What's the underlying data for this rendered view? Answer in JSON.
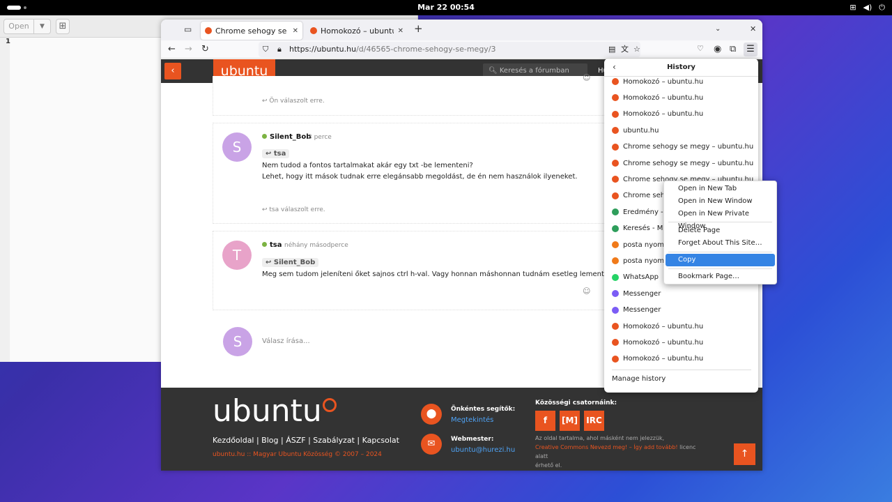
{
  "system": {
    "clock": "Mar 22  00:54",
    "tray": [
      "network-icon",
      "volume-icon",
      "power-icon"
    ]
  },
  "editor": {
    "open_label": "Open",
    "line_number": "1"
  },
  "browser": {
    "tabs": [
      {
        "title": "Chrome sehogy se megy – ubuntu.hu",
        "active": true
      },
      {
        "title": "Homokozó – ubuntu.hu",
        "active": false
      }
    ],
    "url_host": "https://ubuntu.hu",
    "url_path": "/d/46565-chrome-sehogy-se-megy/3"
  },
  "site": {
    "logo": "ubuntu",
    "search_placeholder": "Keresés a fórumban",
    "head_text": "Hu"
  },
  "posts": [
    {
      "replied": "Ön válaszolt erre."
    },
    {
      "initial": "S",
      "color": "#c9a3e6",
      "user": "Silent_Bob",
      "time": "3 perce",
      "reply_to": "tsa",
      "lines": [
        "Nem tudod a fontos tartalmakat akár egy txt -be lementeni?",
        "Lehet, hogy itt mások tudnak erre elegánsabb megoldást, de én nem használok ilyeneket."
      ],
      "replied": "tsa válaszolt erre."
    },
    {
      "initial": "T",
      "color": "#e8a3c9",
      "user": "tsa",
      "time": "néhány másodperce",
      "reply_to": "Silent_Bob",
      "lines": [
        "Meg sem tudom jeleníteni őket sajnos ctrl h-val. Vagy honnan máshonnan tudnám esetleg lementeni?"
      ]
    }
  ],
  "reply_box": {
    "initial": "S",
    "placeholder": "Válasz írása..."
  },
  "footer": {
    "logo": "ubuntu",
    "links": "Kezdőoldal | Blog | ÁSZF | Szabályzat | Kapcsolat",
    "copyright": "ubuntu.hu :: Magyar Ubuntu Közösség © 2007 – 2024",
    "helpers_title": "Önkéntes segítők:",
    "helpers_link": "Megtekintés",
    "webmaster_title": "Webmester:",
    "webmaster_link": "ubuntu@hurezi.hu",
    "social_title": "Közösségi csatornáink:",
    "social": [
      "f",
      "[M]",
      "IRC"
    ],
    "license_1": "Az oldal tartalma, ahol másként nem jelezzük,",
    "license_link": "Creative Commons Nevezd meg! – Így add tovább!",
    "license_2": " licenc alatt",
    "license_3": "érhető el."
  },
  "history": {
    "title": "History",
    "items": [
      {
        "label": "Homokozó – ubuntu.hu",
        "color": "#e95420"
      },
      {
        "label": "Homokozó – ubuntu.hu",
        "color": "#e95420"
      },
      {
        "label": "Homokozó – ubuntu.hu",
        "color": "#e95420"
      },
      {
        "label": "ubuntu.hu",
        "color": "#e95420"
      },
      {
        "label": "Chrome sehogy se megy – ubuntu.hu",
        "color": "#e95420"
      },
      {
        "label": "Chrome sehogy se megy – ubuntu.hu",
        "color": "#e95420"
      },
      {
        "label": "Chrome sehogy se megy – ubuntu.hu",
        "color": "#e95420"
      },
      {
        "label": "Chrome seho",
        "color": "#e95420"
      },
      {
        "label": "Eredmény - M",
        "color": "#2e9e5b"
      },
      {
        "label": "Keresés - Ma",
        "color": "#2e9e5b"
      },
      {
        "label": "posta nyomo",
        "color": "#f07a1a"
      },
      {
        "label": "posta nyomo",
        "color": "#f07a1a"
      },
      {
        "label": "WhatsApp",
        "color": "#25d366"
      },
      {
        "label": "Messenger",
        "color": "#7b5cf5"
      },
      {
        "label": "Messenger",
        "color": "#7b5cf5"
      },
      {
        "label": "Homokozó – ubuntu.hu",
        "color": "#e95420"
      },
      {
        "label": "Homokozó – ubuntu.hu",
        "color": "#e95420"
      },
      {
        "label": "Homokozó – ubuntu.hu",
        "color": "#e95420"
      }
    ],
    "manage": "Manage history"
  },
  "context_menu": {
    "items": [
      {
        "label": "Open in New Tab"
      },
      {
        "label": "Open in New Window"
      },
      {
        "label": "Open in New Private Window"
      },
      {
        "label": "Delete Page"
      },
      {
        "label": "Forget About This Site…"
      },
      {
        "label": "Copy",
        "selected": true
      },
      {
        "label": "Bookmark Page…"
      }
    ]
  }
}
